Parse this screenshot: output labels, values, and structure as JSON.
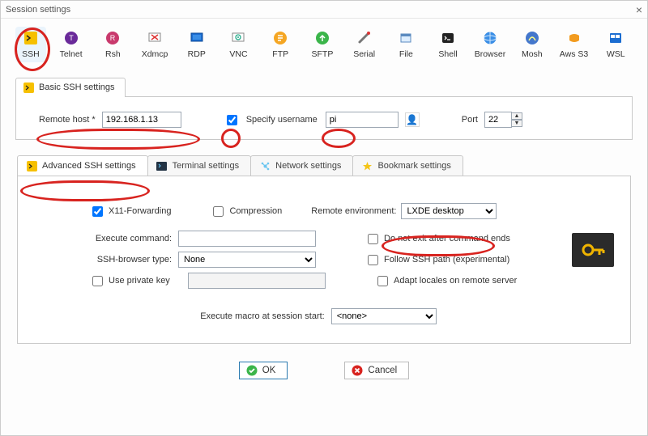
{
  "window": {
    "title": "Session settings"
  },
  "toolbar": {
    "items": [
      {
        "label": "SSH"
      },
      {
        "label": "Telnet"
      },
      {
        "label": "Rsh"
      },
      {
        "label": "Xdmcp"
      },
      {
        "label": "RDP"
      },
      {
        "label": "VNC"
      },
      {
        "label": "FTP"
      },
      {
        "label": "SFTP"
      },
      {
        "label": "Serial"
      },
      {
        "label": "File"
      },
      {
        "label": "Shell"
      },
      {
        "label": "Browser"
      },
      {
        "label": "Mosh"
      },
      {
        "label": "Aws S3"
      },
      {
        "label": "WSL"
      }
    ]
  },
  "basic_tab": {
    "label": "Basic SSH settings"
  },
  "basic": {
    "remote_host_label": "Remote host *",
    "remote_host_value": "192.168.1.13",
    "specify_username_label": "Specify username",
    "specify_username_checked": true,
    "username_value": "pi",
    "port_label": "Port",
    "port_value": "22"
  },
  "subtabs": {
    "advanced": "Advanced SSH settings",
    "terminal": "Terminal settings",
    "network": "Network settings",
    "bookmark": "Bookmark settings"
  },
  "advanced": {
    "x11_label": "X11-Forwarding",
    "x11_checked": true,
    "compression_label": "Compression",
    "compression_checked": false,
    "remote_env_label": "Remote environment:",
    "remote_env_value": "LXDE desktop",
    "exec_cmd_label": "Execute command:",
    "exec_cmd_value": "",
    "no_exit_label": "Do not exit after command ends",
    "no_exit_checked": false,
    "ssh_browser_label": "SSH-browser type:",
    "ssh_browser_value": "None",
    "follow_path_label": "Follow SSH path (experimental)",
    "follow_path_checked": false,
    "private_key_label": "Use private key",
    "private_key_checked": false,
    "private_key_value": "",
    "adapt_locales_label": "Adapt locales on remote server",
    "adapt_locales_checked": false,
    "macro_label": "Execute macro at session start:",
    "macro_value": "<none>"
  },
  "buttons": {
    "ok": "OK",
    "cancel": "Cancel"
  }
}
